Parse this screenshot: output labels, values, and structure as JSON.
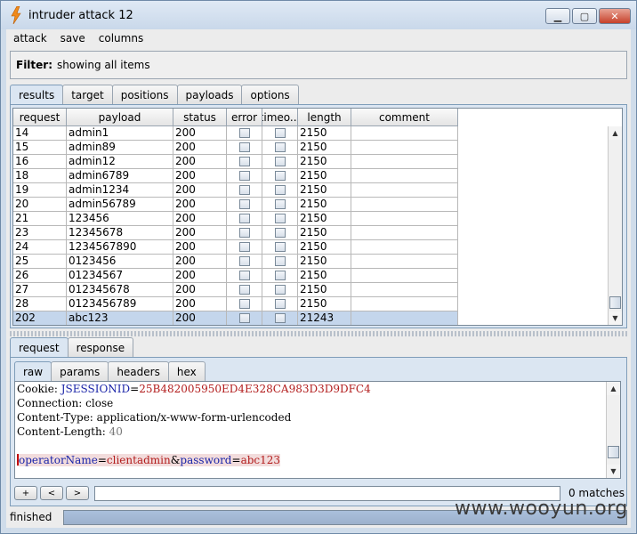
{
  "window": {
    "title": "intruder attack 12"
  },
  "menu": [
    "attack",
    "save",
    "columns"
  ],
  "filter": {
    "label": "Filter:",
    "text": "showing all items"
  },
  "main_tabs": [
    "results",
    "target",
    "positions",
    "payloads",
    "options"
  ],
  "table": {
    "columns": [
      "request",
      "payload",
      "status",
      "error",
      "timeo...",
      "length",
      "comment"
    ],
    "rows": [
      {
        "request": "14",
        "payload": "admin1",
        "status": "200",
        "length": "2150",
        "comment": ""
      },
      {
        "request": "15",
        "payload": "admin89",
        "status": "200",
        "length": "2150",
        "comment": ""
      },
      {
        "request": "16",
        "payload": "admin12",
        "status": "200",
        "length": "2150",
        "comment": ""
      },
      {
        "request": "18",
        "payload": "admin6789",
        "status": "200",
        "length": "2150",
        "comment": ""
      },
      {
        "request": "19",
        "payload": "admin1234",
        "status": "200",
        "length": "2150",
        "comment": ""
      },
      {
        "request": "20",
        "payload": "admin56789",
        "status": "200",
        "length": "2150",
        "comment": ""
      },
      {
        "request": "21",
        "payload": "123456",
        "status": "200",
        "length": "2150",
        "comment": ""
      },
      {
        "request": "23",
        "payload": "12345678",
        "status": "200",
        "length": "2150",
        "comment": ""
      },
      {
        "request": "24",
        "payload": "1234567890",
        "status": "200",
        "length": "2150",
        "comment": ""
      },
      {
        "request": "25",
        "payload": "0123456",
        "status": "200",
        "length": "2150",
        "comment": ""
      },
      {
        "request": "26",
        "payload": "01234567",
        "status": "200",
        "length": "2150",
        "comment": ""
      },
      {
        "request": "27",
        "payload": "012345678",
        "status": "200",
        "length": "2150",
        "comment": ""
      },
      {
        "request": "28",
        "payload": "0123456789",
        "status": "200",
        "length": "2150",
        "comment": ""
      },
      {
        "request": "202",
        "payload": "abc123",
        "status": "200",
        "length": "21243",
        "comment": "",
        "selected": true
      }
    ]
  },
  "detail_tabs": [
    "request",
    "response"
  ],
  "view_tabs": [
    "raw",
    "params",
    "headers",
    "hex"
  ],
  "raw": {
    "cookie_key": "Cookie: ",
    "cookie_name": "JSESSIONID",
    "cookie_eq": "=",
    "cookie_value": "25B482005950ED4E328CA983D3D9DFC4",
    "connection": "Connection: close",
    "content_type": "Content-Type: application/x-www-form-urlencoded",
    "content_length_key": "Content-Length: ",
    "content_length_value": "40",
    "p1_name": "operatorName",
    "p1_eq": "=",
    "p1_value": "clientadmin",
    "amp": "&",
    "p2_name": "password",
    "p2_eq": "=",
    "p2_value": "abc123"
  },
  "search": {
    "plus": "+",
    "prev": "<",
    "next": ">",
    "value": "",
    "matches": "0 matches"
  },
  "status": {
    "text": "finished"
  },
  "watermark": "www.wooyun.org"
}
